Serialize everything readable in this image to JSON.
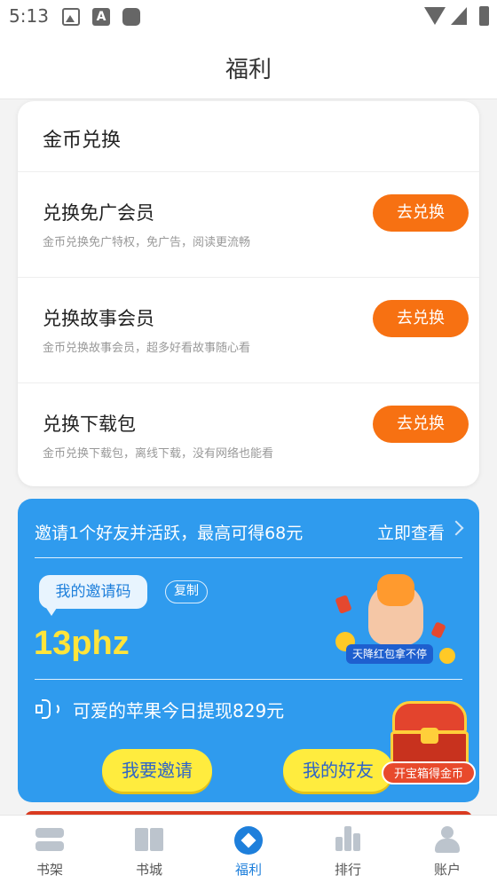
{
  "status_bar": {
    "time": "5:13",
    "icons": [
      "image-icon",
      "a-icon",
      "square-icon",
      "wifi-icon",
      "signal-icon",
      "battery-icon"
    ]
  },
  "header": {
    "title": "福利"
  },
  "exchange": {
    "title": "金币兑换",
    "items": [
      {
        "title": "兑换免广会员",
        "desc": "金币兑换免广特权，免广告，阅读更流畅",
        "button": "去兑换"
      },
      {
        "title": "兑换故事会员",
        "desc": "金币兑换故事会员，超多好看故事随心看",
        "button": "去兑换"
      },
      {
        "title": "兑换下载包",
        "desc": "金币兑换下载包，离线下载，没有网络也能看",
        "button": "去兑换"
      }
    ]
  },
  "invite": {
    "headline": "邀请1个好友并活跃，最高可得68元",
    "view_link": "立即查看",
    "code_label": "我的邀请码",
    "copy_label": "复制",
    "code": "13phz",
    "promo_ribbon": "天降红包拿不停",
    "broadcast": "可爱的苹果今日提现829元",
    "invite_button": "我要邀请",
    "friends_button": "我的好友",
    "chest_label": "开宝箱得金币"
  },
  "nav": {
    "items": [
      {
        "label": "书架",
        "icon": "bookshelf-icon",
        "active": false
      },
      {
        "label": "书城",
        "icon": "book-icon",
        "active": false
      },
      {
        "label": "福利",
        "icon": "welfare-icon",
        "active": true
      },
      {
        "label": "排行",
        "icon": "ranking-icon",
        "active": false
      },
      {
        "label": "账户",
        "icon": "account-icon",
        "active": false
      }
    ]
  },
  "colors": {
    "accent_orange": "#f77112",
    "invite_blue": "#2f9bee",
    "nav_active": "#1e7fdb",
    "code_yellow": "#ffe43a"
  }
}
